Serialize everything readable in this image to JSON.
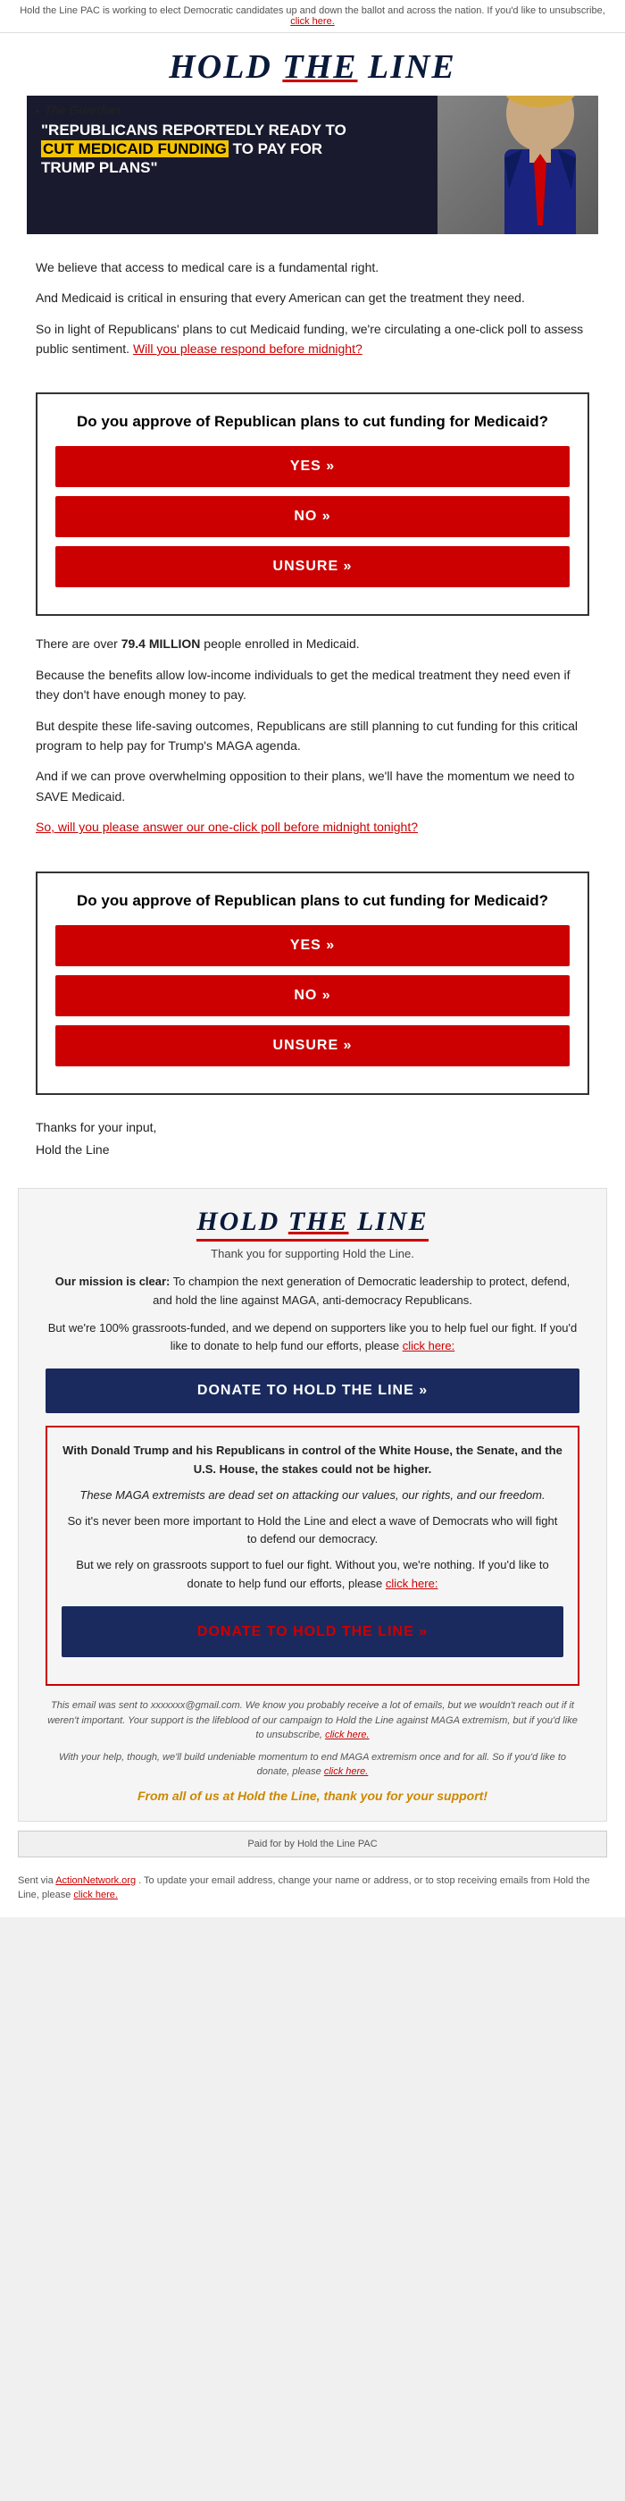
{
  "topbar": {
    "text": "Hold the Line PAC is working to elect Democratic candidates up and down the ballot and across the nation. If you'd like to unsubscribe,",
    "link_text": "click here."
  },
  "header": {
    "logo": "HOLD THE LINE"
  },
  "hero": {
    "guardian_label": "The Guardian",
    "headline_part1": "\"REPUBLICANS REPORTEDLY READY TO",
    "headline_highlight": "CUT MEDICAID FUNDING",
    "headline_part2": "TO PAY FOR TRUMP PLANS\""
  },
  "body_paragraphs": {
    "p1": "We believe that access to medical care is a fundamental right.",
    "p2": "And Medicaid is critical in ensuring that every American can get the treatment they need.",
    "p3": "So in light of Republicans' plans to cut Medicaid funding, we're circulating a one-click poll to assess public sentiment.",
    "p3_link": "Will you please respond before midnight?",
    "poll1": {
      "question": "Do you approve of Republican plans to cut funding for Medicaid?",
      "yes_label": "YES »",
      "no_label": "NO »",
      "unsure_label": "UNSURE »"
    }
  },
  "middle_paragraphs": {
    "p1": "There are over",
    "bold": "79.4 MILLION",
    "p1_end": "people enrolled in Medicaid.",
    "p2": "Because the benefits allow low-income individuals to get the medical treatment they need even if they don't have enough money to pay.",
    "p3": "But despite these life-saving outcomes, Republicans are still planning to cut funding for this critical program to help pay for Trump's MAGA agenda.",
    "p4": "And if we can prove overwhelming opposition to their plans, we'll have the momentum we need to SAVE Medicaid.",
    "link_text": "So, will you please answer our one-click poll before midnight tonight?",
    "poll2": {
      "question": "Do you approve of Republican plans to cut funding for Medicaid?",
      "yes_label": "YES »",
      "no_label": "NO »",
      "unsure_label": "UNSURE »"
    }
  },
  "signoff": {
    "line1": "Thanks for your input,",
    "line2": "Hold the Line"
  },
  "footer": {
    "logo": "HOLD THE LINE",
    "tagline": "Thank you for supporting Hold the Line.",
    "mission_bold": "Our mission is clear:",
    "mission_text": "To champion the next generation of Democratic leadership to protect, defend, and hold the line against MAGA, anti-democracy Republicans.",
    "grassroots_text": "But we're 100% grassroots-funded, and we depend on supporters like you to help fuel our fight. If you'd like to donate to help fund our efforts, please",
    "grassroots_link": "click here:",
    "donate_label": "DONATE TO HOLD THE LINE »",
    "red_box": {
      "line1": "With Donald Trump and his Republicans in control of the White House, the Senate, and the U.S. House, the stakes could not be higher.",
      "line2": "These MAGA extremists are dead set on attacking our values, our rights, and our freedom.",
      "line3": "So it's never been more important to Hold the Line and elect a wave of Democrats who will fight to defend our democracy.",
      "line4_pre": "But we rely on grassroots support to fuel our fight. Without you, we're nothing. If you'd like to donate to help fund our efforts, please",
      "line4_link": "click here:",
      "donate_label2": "DONATE TO HOLD THE LINE »"
    },
    "disclaimer1": "This email was sent to xxxxxxx@gmail.com. We know you probably receive a lot of emails, but we wouldn't reach out if it weren't important. Your support is the lifeblood of our campaign to Hold the Line against MAGA extremism, but if you'd like to unsubscribe,",
    "disclaimer1_link": "click here.",
    "disclaimer2_pre": "With your help, though, we'll build undeniable momentum to end MAGA extremism once and for all. So if you'd like to donate, please",
    "disclaimer2_link": "click here.",
    "gold_line": "From all of us at Hold the Line, thank you for your support!"
  },
  "paid_for": "Paid for by Hold the Line PAC",
  "very_bottom": {
    "text1": "Sent via",
    "link1_text": "ActionNetwork.org",
    "text2": ". To update your email address, change your name or address, or to stop receiving emails from Hold the Line, please",
    "link2_text": "click here."
  }
}
